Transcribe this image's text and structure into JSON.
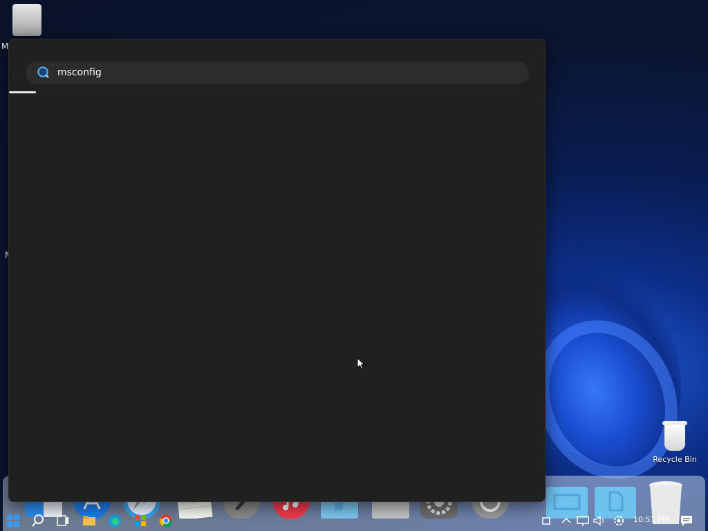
{
  "desktop": {
    "icons": [
      {
        "label": "M"
      },
      {
        "label": "N"
      },
      {
        "label": "Recycle Bin"
      }
    ]
  },
  "search": {
    "query": "msconfig",
    "progress": 0.05
  },
  "dock": {
    "items": [
      "finder-icon",
      "app-store-icon",
      "safari-icon",
      "notes-icon",
      "launchpad-rocket-icon",
      "music-icon",
      "folder-icon",
      "disk-icon",
      "system-preferences-icon",
      "power-icon",
      "folder-icon",
      "documents-folder-icon",
      "trash-icon"
    ]
  },
  "taskbar": {
    "items": [
      "start-icon",
      "search-icon",
      "task-view-icon",
      "file-explorer-icon",
      "edge-icon",
      "store-icon",
      "chrome-icon"
    ],
    "tray": [
      "tray-app-icon",
      "chevron-up-icon",
      "network-icon",
      "volume-icon",
      "gear-icon",
      "notification-icon"
    ],
    "clock": "10:51 PM"
  },
  "colors": {
    "panel_bg": "#202020",
    "search_bg": "#2c2c2c",
    "accent_blue": "#1a4fd6"
  }
}
